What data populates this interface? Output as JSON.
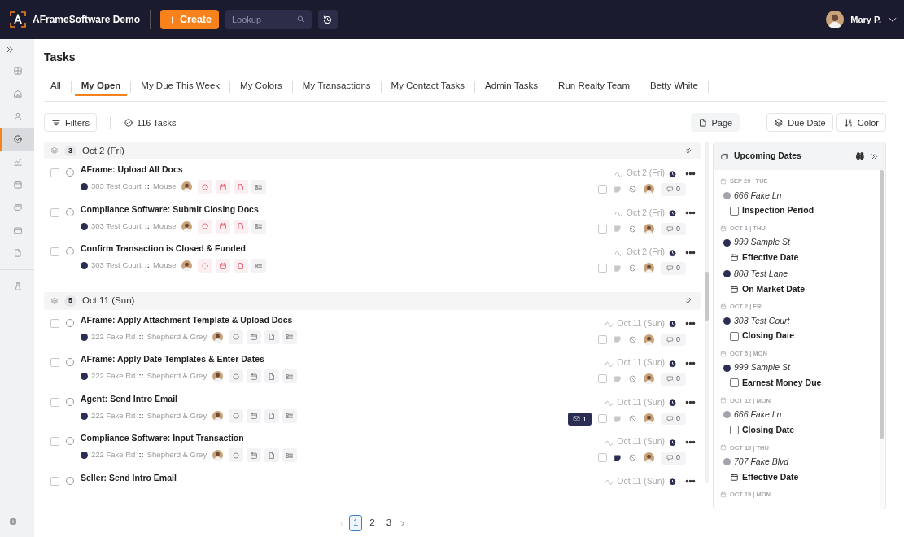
{
  "app": {
    "name": "AFrameSoftware Demo",
    "create_label": "Create",
    "lookup_placeholder": "Lookup",
    "user_name": "Mary P."
  },
  "sidebar": {
    "items": [
      {
        "selected": false
      },
      {
        "selected": false
      },
      {
        "selected": false
      },
      {
        "selected": true
      },
      {
        "selected": false
      },
      {
        "selected": false
      },
      {
        "selected": false
      },
      {
        "selected": false
      },
      {
        "selected": false
      },
      {
        "selected": false
      }
    ]
  },
  "page_title": "Tasks",
  "tabs": [
    {
      "label": "All",
      "selected": false
    },
    {
      "label": "My Open",
      "selected": true
    },
    {
      "label": "My Due This Week",
      "selected": false
    },
    {
      "label": "My Colors",
      "selected": false
    },
    {
      "label": "My Transactions",
      "selected": false
    },
    {
      "label": "My Contact Tasks",
      "selected": false
    },
    {
      "label": "Admin Tasks",
      "selected": false
    },
    {
      "label": "Run Realty Team",
      "selected": false
    },
    {
      "label": "Betty White",
      "selected": false
    }
  ],
  "toolbar": {
    "filters_label": "Filters",
    "task_count": "116 Tasks",
    "view_button": "Page",
    "group_button": "Due Date",
    "sort_button": "Color"
  },
  "groups": [
    {
      "count": "3",
      "label": "Oct 2 (Fri)",
      "tasks": [
        {
          "selected": false,
          "title": "AFrame: Upload All Docs",
          "property": "303 Test Court",
          "separator": "::",
          "contact": "Mouse",
          "due": "Oct 2 (Fri)",
          "checked": false,
          "comments": "0",
          "overdue": true,
          "notes": false
        },
        {
          "selected": false,
          "title": "Compliance Software: Submit Closing Docs",
          "property": "303 Test Court",
          "separator": "::",
          "contact": "Mouse",
          "due": "Oct 2 (Fri)",
          "checked": false,
          "comments": "0",
          "overdue": true,
          "notes": false
        },
        {
          "selected": false,
          "title": "Confirm Transaction is Closed & Funded",
          "property": "303 Test Court",
          "separator": "::",
          "contact": "Mouse",
          "due": "Oct 2 (Fri)",
          "checked": false,
          "comments": "0",
          "overdue": true,
          "notes": false
        }
      ]
    },
    {
      "count": "5",
      "label": "Oct 11 (Sun)",
      "tasks": [
        {
          "selected": false,
          "title": "AFrame: Apply Attachment Template & Upload Docs",
          "property": "222 Fake Rd",
          "separator": "::",
          "contact": "Shepherd & Grey",
          "due": "Oct 11 (Sun)",
          "checked": false,
          "comments": "0",
          "overdue": false,
          "notes": false
        },
        {
          "selected": false,
          "title": "AFrame: Apply Date Templates & Enter Dates",
          "property": "222 Fake Rd",
          "separator": "::",
          "contact": "Shepherd & Grey",
          "due": "Oct 11 (Sun)",
          "checked": false,
          "comments": "0",
          "overdue": false,
          "notes": false
        },
        {
          "selected": false,
          "title": "Agent: Send Intro Email",
          "property": "222 Fake Rd",
          "separator": "::",
          "contact": "Shepherd & Grey",
          "due": "Oct 11 (Sun)",
          "checked": false,
          "comments": "0",
          "overdue": false,
          "notes": false,
          "emails": "1"
        },
        {
          "selected": false,
          "title": "Compliance Software: Input Transaction",
          "property": "222 Fake Rd",
          "separator": "::",
          "contact": "Shepherd & Grey",
          "due": "Oct 11 (Sun)",
          "checked": false,
          "comments": "0",
          "overdue": false,
          "notes": true
        },
        {
          "selected": false,
          "title": "Seller: Send Intro Email",
          "due": "Oct 11 (Sun)"
        }
      ]
    }
  ],
  "pagination": {
    "pages": [
      {
        "label": "1",
        "selected": true
      },
      {
        "label": "2",
        "selected": false
      },
      {
        "label": "3",
        "selected": false
      }
    ]
  },
  "upcoming": {
    "title": "Upcoming Dates",
    "days": [
      {
        "label": "SEP 29 | TUE",
        "items": [
          {
            "property": "666 Fake Ln",
            "color": "#a3a3ab",
            "kind": "task",
            "checked": false,
            "label": "Inspection Period"
          }
        ]
      },
      {
        "label": "OCT 1 | THU",
        "items": [
          {
            "property": "999 Sample St",
            "color": "#2b2d52",
            "kind": "date",
            "label": "Effective Date"
          },
          {
            "property": "808 Test Lane",
            "color": "#2b2d52",
            "kind": "date",
            "label": "On Market Date"
          }
        ]
      },
      {
        "label": "OCT 2 | FRI",
        "items": [
          {
            "property": "303 Test Court",
            "color": "#2b2d52",
            "kind": "task",
            "checked": false,
            "label": "Closing Date"
          }
        ]
      },
      {
        "label": "OCT 5 | MON",
        "items": [
          {
            "property": "999 Sample St",
            "color": "#2b2d52",
            "kind": "task",
            "checked": false,
            "label": "Earnest Money Due"
          }
        ]
      },
      {
        "label": "OCT 12 | MON",
        "items": [
          {
            "property": "666 Fake Ln",
            "color": "#a3a3ab",
            "kind": "task",
            "checked": false,
            "label": "Closing Date"
          }
        ]
      },
      {
        "label": "OCT 15 | THU",
        "items": [
          {
            "property": "707 Fake Blvd",
            "color": "#a3a3ab",
            "kind": "date",
            "label": "Effective Date"
          }
        ]
      },
      {
        "label": "OCT 19 | MON"
      }
    ]
  }
}
